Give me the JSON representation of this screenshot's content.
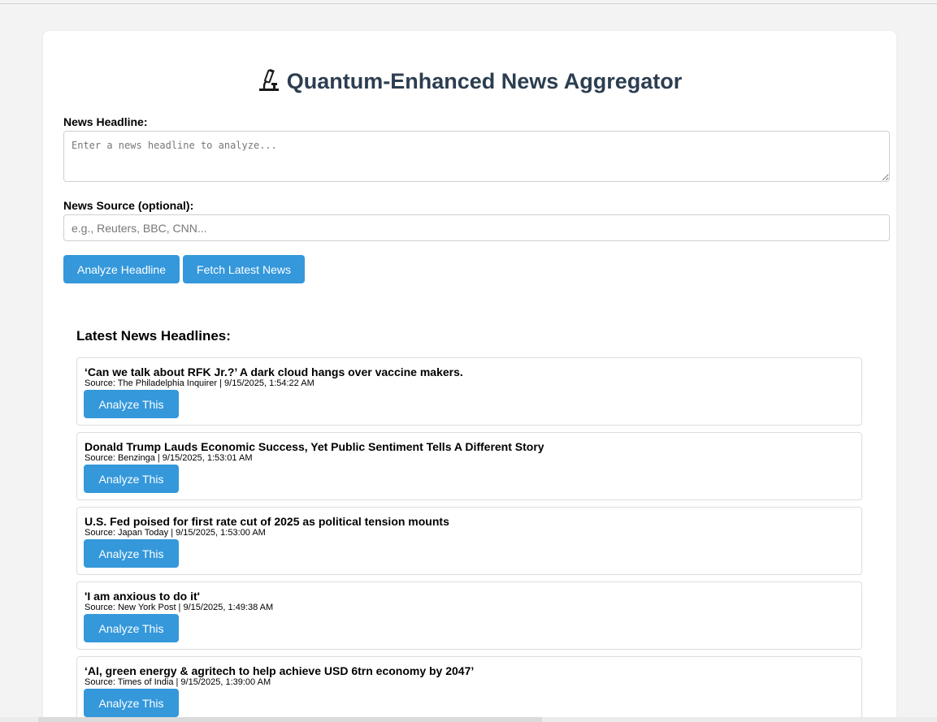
{
  "header": {
    "title": "Quantum-Enhanced News Aggregator"
  },
  "form": {
    "headline_label": "News Headline:",
    "headline_placeholder": "Enter a news headline to analyze...",
    "source_label": "News Source (optional):",
    "source_placeholder": "e.g., Reuters, BBC, CNN...",
    "analyze_button": "Analyze Headline",
    "fetch_button": "Fetch Latest News"
  },
  "news": {
    "heading": "Latest News Headlines:",
    "analyze_label": "Analyze This",
    "items": [
      {
        "title": "‘Can we talk about RFK Jr.?’ A dark cloud hangs over vaccine makers.",
        "meta": "Source: The Philadelphia Inquirer | 9/15/2025, 1:54:22 AM"
      },
      {
        "title": "Donald Trump Lauds Economic Success, Yet Public Sentiment Tells A Different Story",
        "meta": "Source: Benzinga | 9/15/2025, 1:53:01 AM"
      },
      {
        "title": "U.S. Fed poised for first rate cut of 2025 as political tension mounts",
        "meta": "Source: Japan Today | 9/15/2025, 1:53:00 AM"
      },
      {
        "title": "'I am anxious to do it'",
        "meta": "Source: New York Post | 9/15/2025, 1:49:38 AM"
      },
      {
        "title": "‘AI, green energy & agritech to help achieve USD 6trn economy by 2047’",
        "meta": "Source: Times of India | 9/15/2025, 1:39:00 AM"
      }
    ]
  },
  "colors": {
    "accent": "#3498db",
    "title": "#2c3e50"
  }
}
